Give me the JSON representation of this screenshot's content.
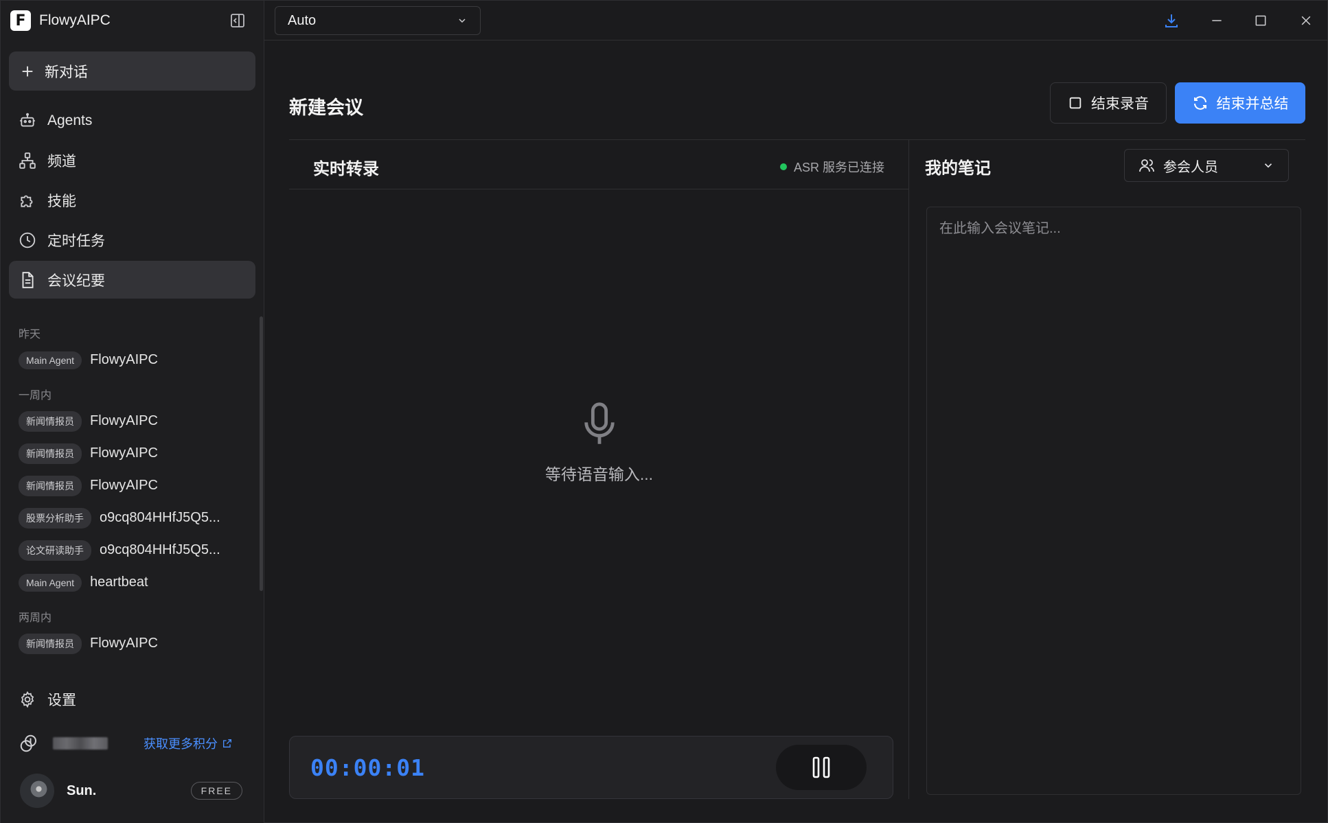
{
  "app": {
    "name": "FlowyAIPC",
    "logo_letter": "F"
  },
  "sidebar": {
    "new_chat_label": "新对话",
    "nav": [
      {
        "label": "Agents",
        "icon": "robot-icon"
      },
      {
        "label": "频道",
        "icon": "channel-icon"
      },
      {
        "label": "技能",
        "icon": "puzzle-icon"
      },
      {
        "label": "定时任务",
        "icon": "clock-icon"
      },
      {
        "label": "会议纪要",
        "icon": "document-icon",
        "active": true
      }
    ],
    "history": [
      {
        "group": "昨天",
        "items": [
          {
            "tag": "Main Agent",
            "title": "FlowyAIPC"
          }
        ]
      },
      {
        "group": "一周内",
        "items": [
          {
            "tag": "新闻情报员",
            "title": "FlowyAIPC"
          },
          {
            "tag": "新闻情报员",
            "title": "FlowyAIPC"
          },
          {
            "tag": "新闻情报员",
            "title": "FlowyAIPC"
          },
          {
            "tag": "股票分析助手",
            "title": "o9cq804HHfJ5Q5..."
          },
          {
            "tag": "论文研读助手",
            "title": "o9cq804HHfJ5Q5..."
          },
          {
            "tag": "Main Agent",
            "title": "heartbeat"
          }
        ]
      },
      {
        "group": "两周内",
        "items": [
          {
            "tag": "新闻情报员",
            "title": "FlowyAIPC"
          }
        ]
      }
    ],
    "settings_label": "设置",
    "credits_link": "获取更多积分",
    "user": {
      "name": "Sun.",
      "plan": "FREE"
    }
  },
  "topbar": {
    "model": "Auto"
  },
  "main": {
    "title": "新建会议",
    "stop_recording_label": "结束录音",
    "end_and_summarize_label": "结束并总结",
    "transcript": {
      "title": "实时转录",
      "asr_status": "ASR 服务已连接",
      "waiting_text": "等待语音输入...",
      "timer": "00:00:01"
    },
    "notes": {
      "title": "我的笔记",
      "participants_label": "参会人员",
      "placeholder": "在此输入会议笔记..."
    }
  },
  "colors": {
    "accent": "#3b82f6",
    "status_ok": "#22c55e",
    "background": "#1b1b1d",
    "sidebar": "#1e1e20"
  }
}
